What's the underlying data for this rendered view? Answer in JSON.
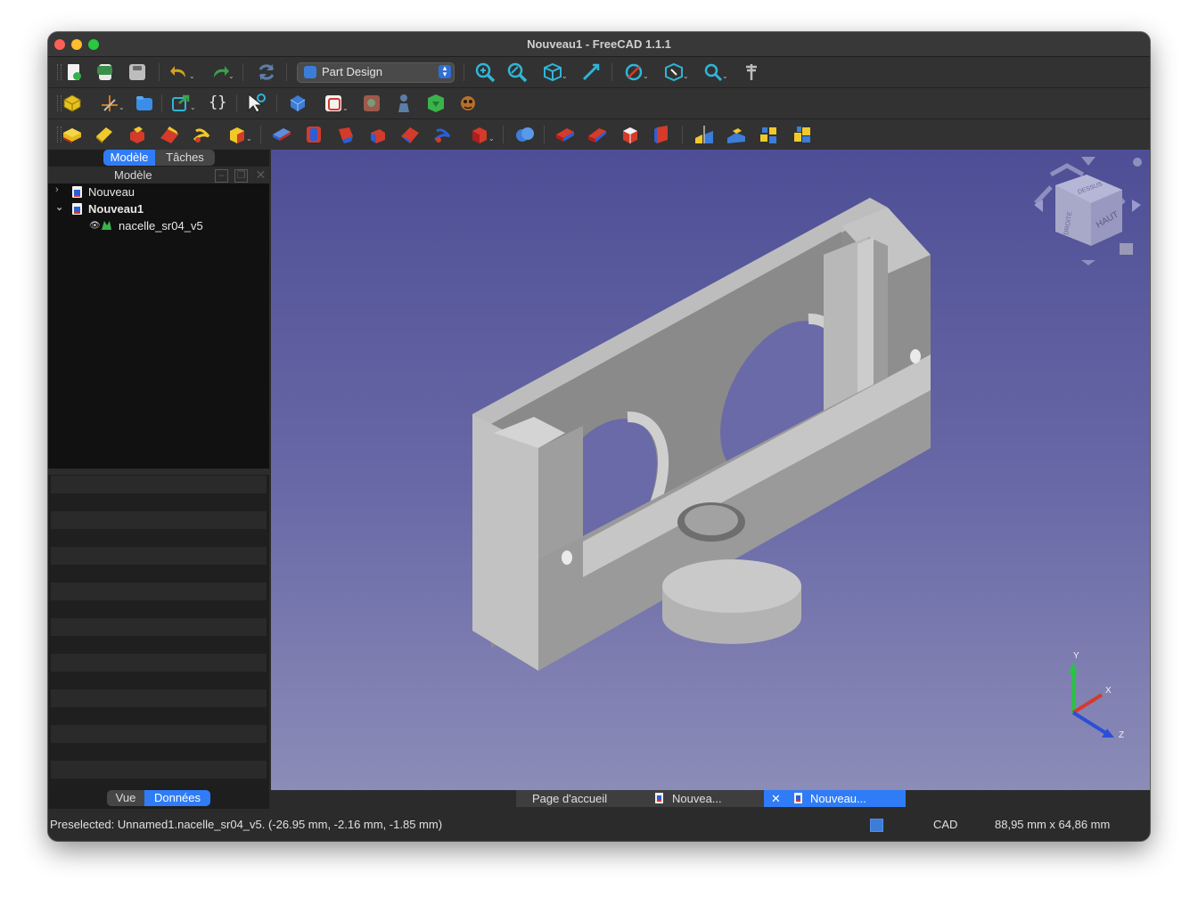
{
  "window": {
    "title": "Nouveau1 - FreeCAD 1.1.1"
  },
  "toolbar": {
    "workbench_label": "Part Design"
  },
  "combo_view": {
    "tabs": [
      {
        "label": "Modèle",
        "active": true
      },
      {
        "label": "Tâches",
        "active": false
      }
    ],
    "panel_title": "Modèle",
    "tree": [
      {
        "label": "Nouveau",
        "expanded": false,
        "bold": false
      },
      {
        "label": "Nouveau1",
        "expanded": true,
        "bold": true
      },
      {
        "label": "nacelle_sr04_v5",
        "visible": true
      }
    ],
    "property_tabs": [
      {
        "label": "Vue",
        "active": false
      },
      {
        "label": "Données",
        "active": true
      }
    ]
  },
  "navigation_cube": {
    "faces": [
      "DESSUS",
      "HAUT",
      "DROITE"
    ]
  },
  "axis_labels": {
    "x": "X",
    "y": "Y",
    "z": "Z"
  },
  "document_tabs": [
    {
      "label": "Page d'accueil",
      "active": false
    },
    {
      "label": "Nouvea...",
      "active": false
    },
    {
      "label": "Nouveau...",
      "active": true
    }
  ],
  "status": {
    "message": "Preselected: Unnamed1.nacelle_sr04_v5. (-26.95 mm, -2.16 mm, -1.85 mm)",
    "navigation_style": "CAD",
    "dimensions": "88,95 mm x 64,86 mm"
  },
  "colors": {
    "accent": "#2f7cf6",
    "background_top": "#4e4e96",
    "background_bottom": "#8c8cb8",
    "part": "#a9a9a9"
  }
}
